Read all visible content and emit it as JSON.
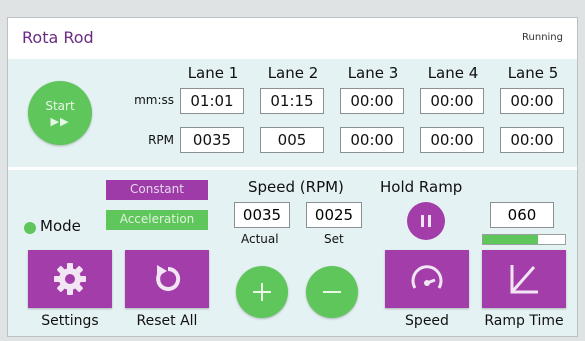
{
  "header": {
    "title": "Rota Rod",
    "status": "Running"
  },
  "start": {
    "label": "Start",
    "arrows": "▶▶"
  },
  "lanes": {
    "headers": [
      "Lane 1",
      "Lane 2",
      "Lane 3",
      "Lane 4",
      "Lane 5"
    ],
    "time_label": "mm:ss",
    "rpm_label": "RPM",
    "times": [
      "01:01",
      "01:15",
      "00:00",
      "00:00",
      "00:00"
    ],
    "rpms": [
      "0035",
      "005",
      "00:00",
      "00:00",
      "00:00"
    ]
  },
  "mode": {
    "label": "Mode",
    "constant": "Constant",
    "acceleration": "Acceleration"
  },
  "speed": {
    "heading": "Speed (RPM)",
    "actual": "0035",
    "set": "0025",
    "actual_label": "Actual",
    "set_label": "Set"
  },
  "hold": {
    "heading": "Hold Ramp"
  },
  "ramp": {
    "value": "060",
    "progress": 0.67
  },
  "buttons": {
    "settings": "Settings",
    "reset": "Reset All",
    "speed": "Speed",
    "ramp_time": "Ramp Time"
  },
  "colors": {
    "purple": "#a23da9",
    "green": "#5ec65b",
    "panel": "#e5f2f3"
  },
  "icons": {
    "settings": "gear-icon",
    "reset": "reset-icon",
    "plus": "plus-icon",
    "minus": "minus-icon",
    "pause": "pause-icon",
    "speed": "speedometer-icon",
    "ramp_time": "ramp-icon"
  }
}
